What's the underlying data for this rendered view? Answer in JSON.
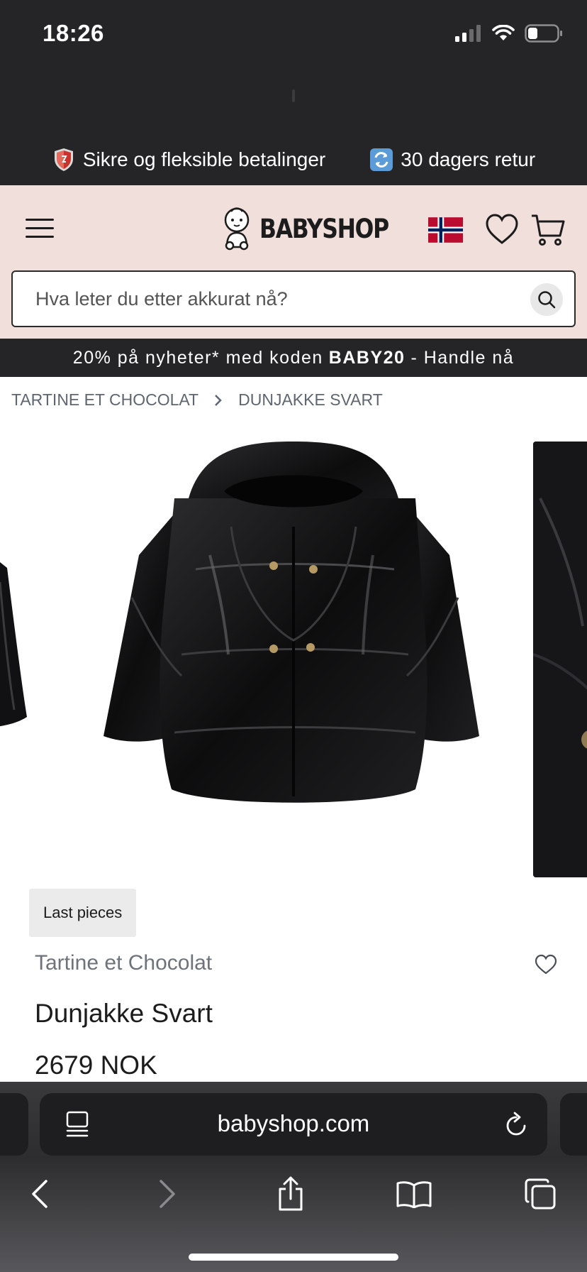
{
  "status_bar": {
    "time": "18:26"
  },
  "promo_bar": {
    "items": [
      {
        "icon": "shield-icon",
        "text": "Sikre og fleksible betalinger"
      },
      {
        "icon": "return-arrows-icon",
        "text": "30 dagers retur"
      }
    ]
  },
  "header": {
    "logo_text": "BABYSHOP",
    "search_placeholder": "Hva leter du etter akkurat nå?"
  },
  "announcement": {
    "before": "20% på nyheter* med koden",
    "code": "BABY20",
    "after": "- Handle nå"
  },
  "breadcrumb": {
    "items": [
      "TARTINE ET CHOCOLAT",
      "DUNJAKKE SVART"
    ]
  },
  "product": {
    "badge": "Last pieces",
    "brand": "Tartine et Chocolat",
    "name": "Dunjakke Svart",
    "price": "2679 NOK"
  },
  "browser": {
    "url": "babyshop.com"
  },
  "colors": {
    "header_bg": "#f1dfdb",
    "dark_bar": "#252527",
    "text_muted": "#6e737a"
  }
}
